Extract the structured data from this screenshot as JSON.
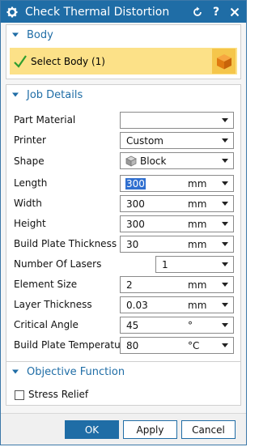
{
  "window": {
    "title": "Check Thermal Distortion",
    "help_glyph": "?",
    "icons": [
      "gear-icon",
      "reset-icon",
      "help-icon",
      "close-icon"
    ]
  },
  "body_section": {
    "title": "Body",
    "select_label": "Select Body (1)",
    "colors": {
      "select_bg": "#fce188",
      "cube": "#f08a1a"
    }
  },
  "job_details": {
    "title": "Job Details",
    "fields": [
      {
        "label": "Part Material",
        "value": "",
        "unit": ""
      },
      {
        "label": "Printer",
        "value": "Custom",
        "unit": ""
      },
      {
        "label": "Shape",
        "value": "Block",
        "unit": ""
      },
      {
        "label": "Length",
        "value": "300",
        "unit": "mm"
      },
      {
        "label": "Width",
        "value": "300",
        "unit": "mm"
      },
      {
        "label": "Height",
        "value": "300",
        "unit": "mm"
      },
      {
        "label": "Build Plate Thickness",
        "value": "30",
        "unit": "mm"
      },
      {
        "label": "Number Of Lasers",
        "value": "1",
        "unit": ""
      },
      {
        "label": "Element Size",
        "value": "2",
        "unit": "mm"
      },
      {
        "label": "Layer Thickness",
        "value": "0.03",
        "unit": "mm"
      },
      {
        "label": "Critical Angle",
        "value": "45",
        "unit": "°"
      },
      {
        "label": "Build Plate Temperature",
        "value": "80",
        "unit": "°C"
      }
    ]
  },
  "objective": {
    "title": "Objective Function",
    "stress_relief_label": "Stress Relief",
    "stress_relief_checked": false
  },
  "buttons": {
    "ok": "OK",
    "apply": "Apply",
    "cancel": "Cancel"
  },
  "theme": {
    "accent": "#1f6da6",
    "title_bar": "#1f6da6"
  }
}
